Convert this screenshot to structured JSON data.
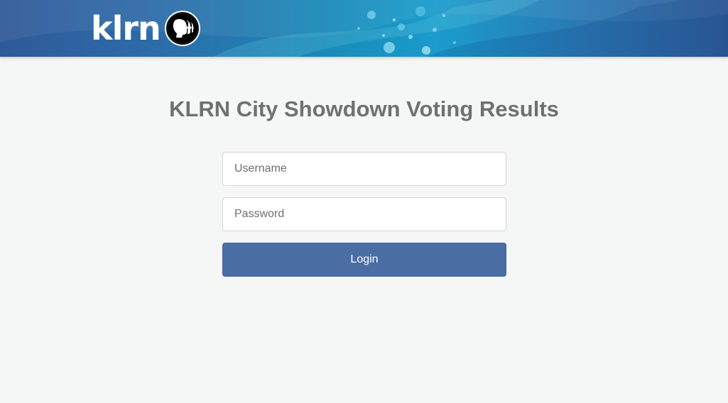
{
  "header": {
    "logo_text": "klrn",
    "logo_mark": "pbs-heads-icon",
    "bg_color": "#2f5a98",
    "accent_color": "#1a9ccc"
  },
  "main": {
    "title": "KLRN City Showdown Voting Results"
  },
  "login_form": {
    "username_placeholder": "Username",
    "username_value": "",
    "password_placeholder": "Password",
    "password_value": "",
    "login_label": "Login",
    "button_color": "#4a6da4"
  }
}
